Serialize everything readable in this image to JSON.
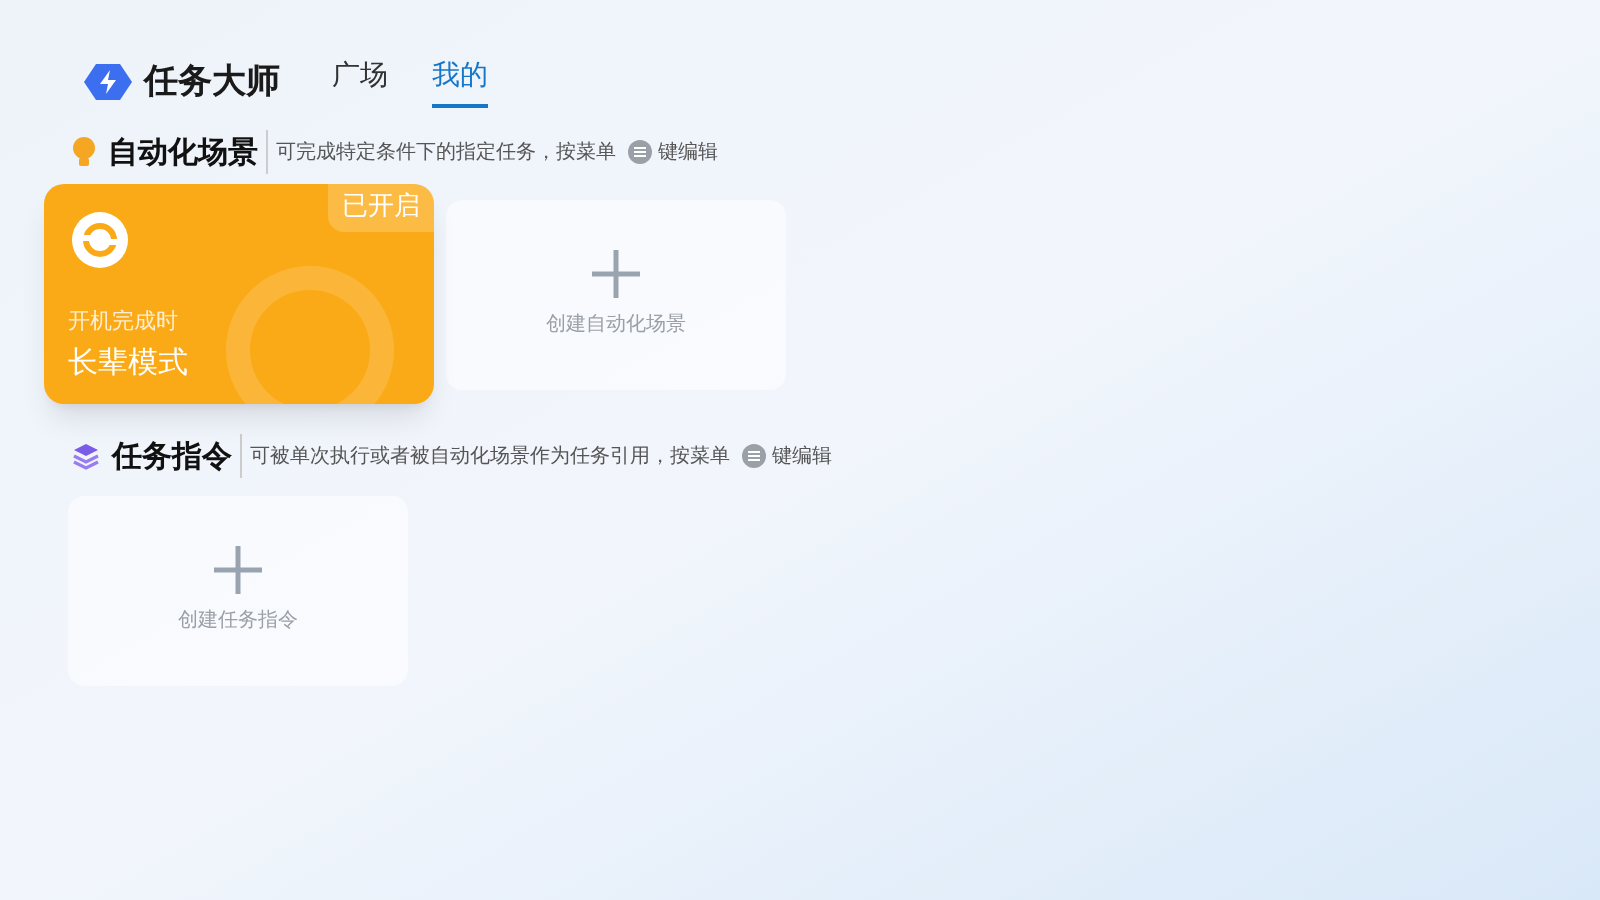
{
  "app": {
    "title": "任务大师"
  },
  "tabs": [
    {
      "label": "广场",
      "selected": false
    },
    {
      "label": "我的",
      "selected": true
    }
  ],
  "sections": [
    {
      "kind": "scenes",
      "title": "自动化场景",
      "hint_before": "可完成特定条件下的指定任务，按菜单",
      "hint_after": "键编辑",
      "cards": [
        {
          "kind": "scene",
          "badge": "已开启",
          "enabled": true,
          "trigger": "开机完成时",
          "name": "长辈模式"
        },
        {
          "kind": "add",
          "label": "创建自动化场景"
        }
      ]
    },
    {
      "kind": "commands",
      "title": "任务指令",
      "hint_before": "可被单次执行或者被自动化场景作为任务引用，按菜单",
      "hint_after": "键编辑",
      "cards": [
        {
          "kind": "add",
          "label": "创建任务指令"
        }
      ]
    }
  ]
}
